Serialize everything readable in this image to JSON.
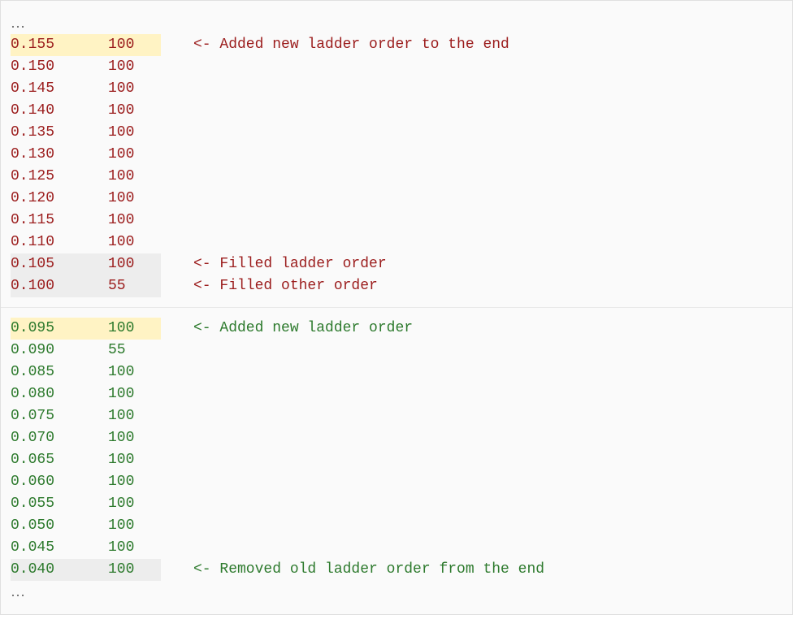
{
  "ellipsis": "…",
  "asks": {
    "color": "#9b1c1c",
    "rows": [
      {
        "price": "0.155",
        "qty": "100",
        "highlight": "yellow",
        "comment": "<- Added new ladder order to the end"
      },
      {
        "price": "0.150",
        "qty": "100",
        "highlight": null,
        "comment": ""
      },
      {
        "price": "0.145",
        "qty": "100",
        "highlight": null,
        "comment": ""
      },
      {
        "price": "0.140",
        "qty": "100",
        "highlight": null,
        "comment": ""
      },
      {
        "price": "0.135",
        "qty": "100",
        "highlight": null,
        "comment": ""
      },
      {
        "price": "0.130",
        "qty": "100",
        "highlight": null,
        "comment": ""
      },
      {
        "price": "0.125",
        "qty": "100",
        "highlight": null,
        "comment": ""
      },
      {
        "price": "0.120",
        "qty": "100",
        "highlight": null,
        "comment": ""
      },
      {
        "price": "0.115",
        "qty": "100",
        "highlight": null,
        "comment": ""
      },
      {
        "price": "0.110",
        "qty": "100",
        "highlight": null,
        "comment": ""
      },
      {
        "price": "0.105",
        "qty": "100",
        "highlight": "gray",
        "comment": "<- Filled ladder order"
      },
      {
        "price": "0.100",
        "qty": "55",
        "highlight": "gray",
        "comment": "<- Filled other order"
      }
    ]
  },
  "bids": {
    "color": "#2d7a2d",
    "rows": [
      {
        "price": "0.095",
        "qty": "100",
        "highlight": "yellow",
        "comment": "<- Added new ladder order"
      },
      {
        "price": "0.090",
        "qty": "55",
        "highlight": null,
        "comment": ""
      },
      {
        "price": "0.085",
        "qty": "100",
        "highlight": null,
        "comment": ""
      },
      {
        "price": "0.080",
        "qty": "100",
        "highlight": null,
        "comment": ""
      },
      {
        "price": "0.075",
        "qty": "100",
        "highlight": null,
        "comment": ""
      },
      {
        "price": "0.070",
        "qty": "100",
        "highlight": null,
        "comment": ""
      },
      {
        "price": "0.065",
        "qty": "100",
        "highlight": null,
        "comment": ""
      },
      {
        "price": "0.060",
        "qty": "100",
        "highlight": null,
        "comment": ""
      },
      {
        "price": "0.055",
        "qty": "100",
        "highlight": null,
        "comment": ""
      },
      {
        "price": "0.050",
        "qty": "100",
        "highlight": null,
        "comment": ""
      },
      {
        "price": "0.045",
        "qty": "100",
        "highlight": null,
        "comment": ""
      },
      {
        "price": "0.040",
        "qty": "100",
        "highlight": "gray",
        "comment": "<- Removed old ladder order from the end"
      }
    ]
  }
}
